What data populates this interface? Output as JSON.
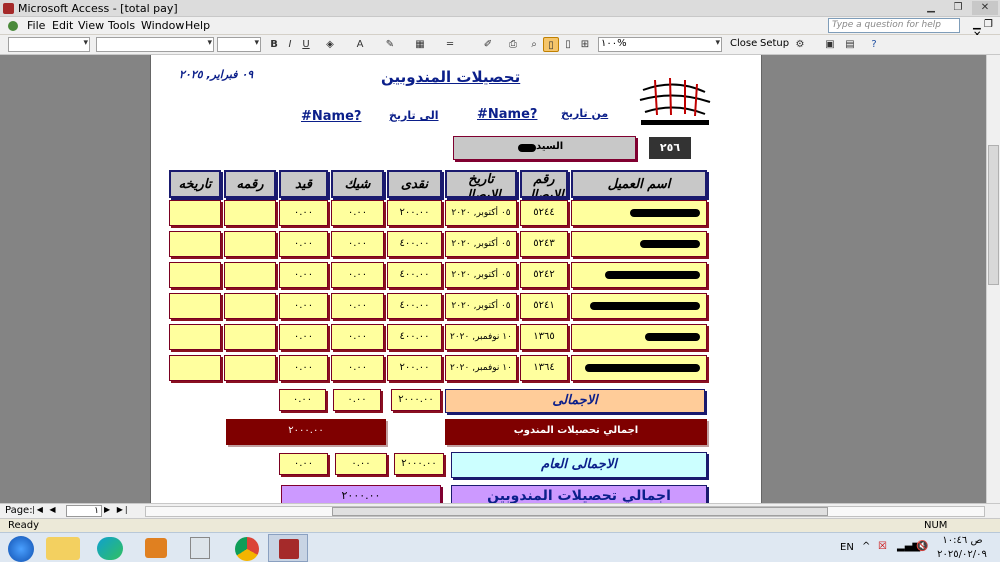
{
  "window": {
    "title": "Microsoft Access - [total pay]"
  },
  "menu": [
    "File",
    "Edit",
    "View",
    "Tools",
    "Window",
    "Help"
  ],
  "help_placeholder": "Type a question for help",
  "toolbar": {
    "zoom": "١٠٠%",
    "close_label": "Close",
    "setup_label": "Setup"
  },
  "report": {
    "date": "٠٩ فبراير, ٢٠٢٥",
    "title": "تحصيلات المندوبين",
    "from_label": "من تاريخ",
    "from_value": "#Name?",
    "to_label": "الى تاريخ",
    "to_value": "#Name?",
    "mr_label": "السيد",
    "rep_code": "٢٥٦",
    "headers": [
      "اسم العميل",
      "رقم الايصال",
      "تاريخ الايصال",
      "نقدى",
      "شيك",
      "قيد",
      "رقمه",
      "تاريخه"
    ],
    "rows": [
      {
        "receipt": "٥٢٤٤",
        "date": "٠٥ أكتوبر, ٢٠٢٠",
        "cash": "٢٠٠.٠٠",
        "cheque": "٠.٠٠",
        "entry": "٠.٠٠"
      },
      {
        "receipt": "٥٢٤٣",
        "date": "٠٥ أكتوبر, ٢٠٢٠",
        "cash": "٤٠٠.٠٠",
        "cheque": "٠.٠٠",
        "entry": "٠.٠٠"
      },
      {
        "receipt": "٥٢٤٢",
        "date": "٠٥ أكتوبر, ٢٠٢٠",
        "cash": "٤٠٠.٠٠",
        "cheque": "٠.٠٠",
        "entry": "٠.٠٠"
      },
      {
        "receipt": "٥٢٤١",
        "date": "٠٥ أكتوبر, ٢٠٢٠",
        "cash": "٤٠٠.٠٠",
        "cheque": "٠.٠٠",
        "entry": "٠.٠٠"
      },
      {
        "receipt": "١٣٦٥",
        "date": "١٠ نوفمبر, ٢٠٢٠",
        "cash": "٤٠٠.٠٠",
        "cheque": "٠.٠٠",
        "entry": "٠.٠٠"
      },
      {
        "receipt": "١٣٦٤",
        "date": "١٠ نوفمبر, ٢٠٢٠",
        "cash": "٢٠٠.٠٠",
        "cheque": "٠.٠٠",
        "entry": "٠.٠٠"
      }
    ],
    "total_label": "الاجمالى",
    "total_cash": "٢٠٠٠.٠٠",
    "total_cheque": "٠.٠٠",
    "total_entry": "٠.٠٠",
    "rep_total_label": "اجمالي تحصيلات المندوب",
    "rep_total_value": "٢٠٠٠.٠٠",
    "grand_label": "الاجمالى العام",
    "grand_cash": "٢٠٠٠.٠٠",
    "grand_cheque": "٠.٠٠",
    "grand_entry": "٠.٠٠",
    "all_label": "اجمالي تحصيلات المندوبين",
    "all_value": "٢٠٠٠.٠٠"
  },
  "nav": {
    "page_label": "Page:",
    "page_value": "١"
  },
  "status": {
    "left": "Ready",
    "num": "NUM"
  },
  "taskbar": {
    "lang": "EN",
    "time": "ص ١٠:٤٦",
    "date": "٢٠٢٥/٠٢/٠٩"
  },
  "colors": {
    "cell_fill": "#ffff9e",
    "header_fill": "#c8c8c8",
    "total_fill": "#ffcc99",
    "rep_total_fill": "#7f0000",
    "grand_fill": "#ccffff",
    "all_fill": "#cc99ff"
  }
}
